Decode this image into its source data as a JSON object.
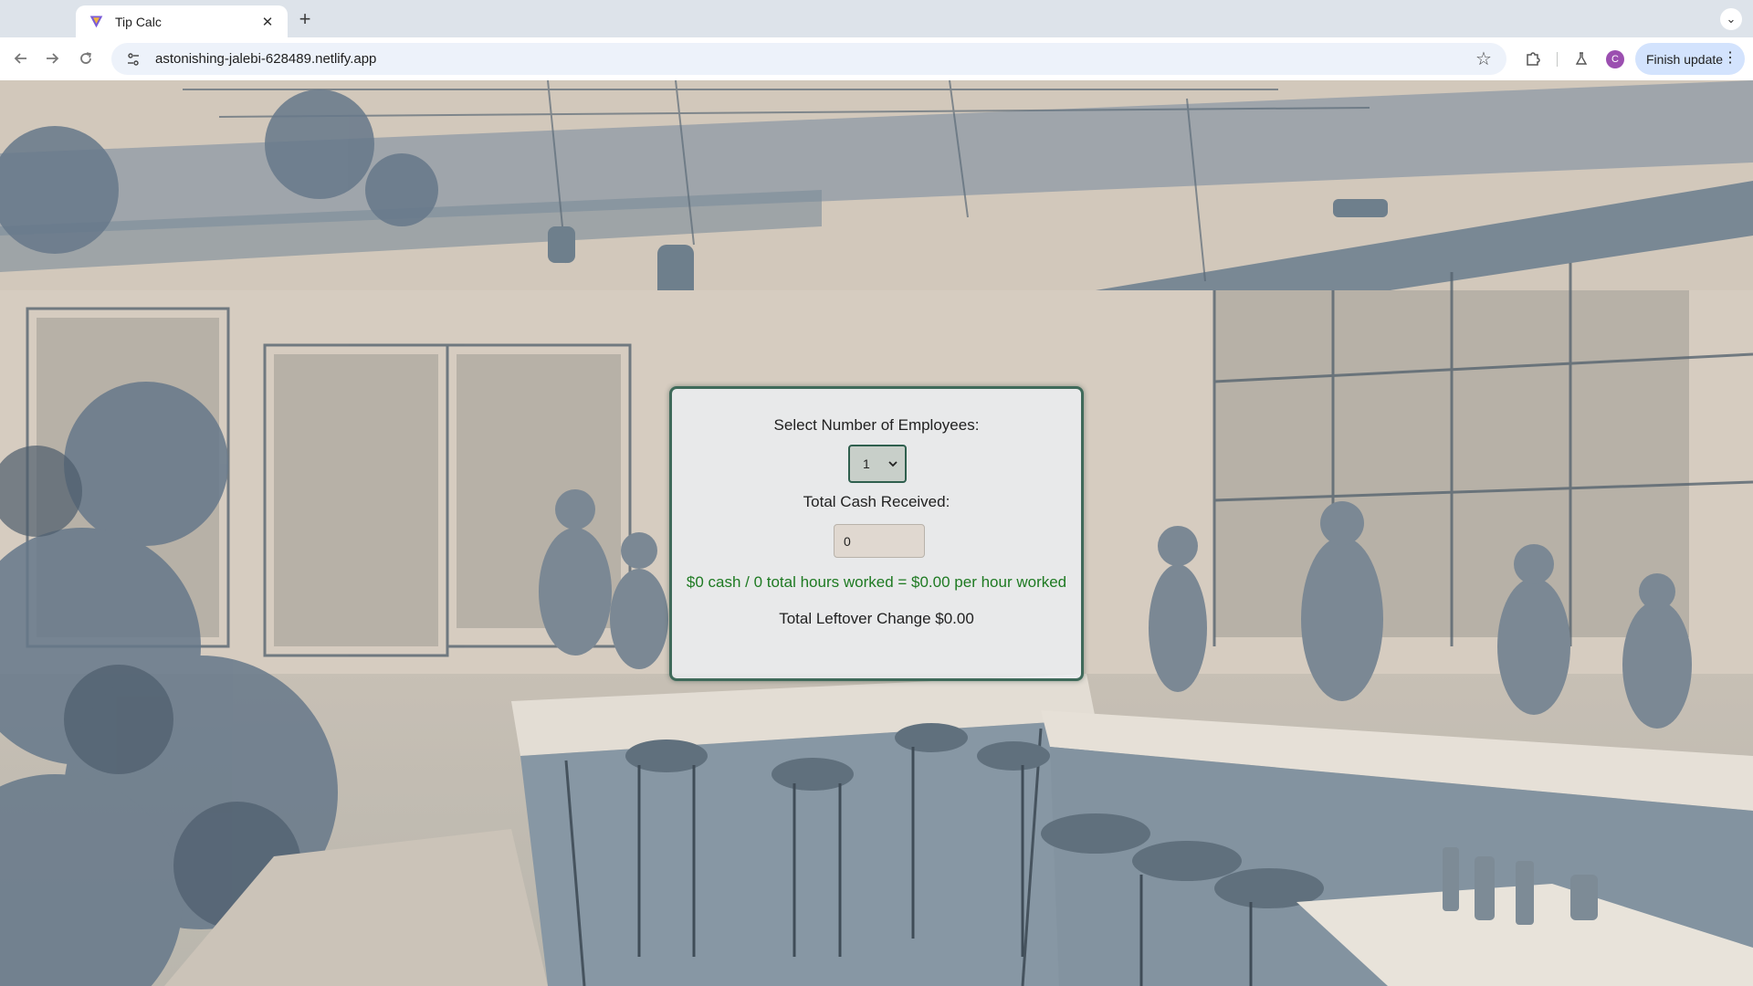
{
  "browser": {
    "tab_title": "Tip Calc",
    "url": "astonishing-jalebi-628489.netlify.app",
    "avatar_letter": "C",
    "update_label": "Finish update",
    "icons": {
      "back": "arrow-left-icon",
      "forward": "arrow-right-icon",
      "reload": "reload-icon",
      "site_info": "tune-icon",
      "bookmark": "star-icon",
      "extensions": "puzzle-icon",
      "labs": "flask-icon",
      "menu": "kebab-menu-icon",
      "tab_search": "chevron-down-icon"
    }
  },
  "app": {
    "employees_label": "Select Number of Employees:",
    "employees_value": "1",
    "cash_label": "Total Cash Received:",
    "cash_value": "0",
    "result_text": "$0 cash / 0 total hours worked = $0.00 per hour worked",
    "leftover_text": "Total Leftover Change $0.00",
    "colors": {
      "card_border": "#3f6a5a",
      "result_text": "#1e7a22"
    }
  }
}
